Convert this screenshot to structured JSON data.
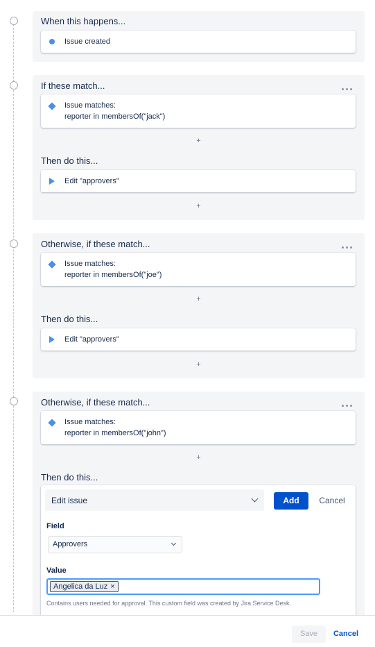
{
  "trigger": {
    "title": "When this happens...",
    "item_label": "Issue created"
  },
  "branch1": {
    "title": "If these match...",
    "condition_line1": "Issue matches:",
    "condition_line2": "reporter in membersOf(\"jack\")",
    "add_symbol": "+",
    "then_title": "Then do this...",
    "action_label": "Edit \"approvers\"",
    "add_symbol2": "+"
  },
  "branch2": {
    "title": "Otherwise, if these match...",
    "condition_line1": "Issue matches:",
    "condition_line2": "reporter in membersOf(\"joe\")",
    "add_symbol": "+",
    "then_title": "Then do this...",
    "action_label": "Edit \"approvers\"",
    "add_symbol2": "+"
  },
  "branch3": {
    "title": "Otherwise, if these match...",
    "condition_line1": "Issue matches:",
    "condition_line2": "reporter in membersOf(\"john\")",
    "add_symbol": "+",
    "then_title": "Then do this..."
  },
  "edit_panel": {
    "action_select_value": "Edit issue",
    "add_label": "Add",
    "cancel_label": "Cancel",
    "field_label": "Field",
    "field_select_value": "Approvers",
    "value_label": "Value",
    "value_tag": "Angelica da Luz",
    "value_tag_remove": "×",
    "help_text": "Contains users needed for approval. This custom field was created by Jira Service Desk."
  },
  "footer": {
    "save_label": "Save",
    "cancel_label": "Cancel"
  },
  "icons": {
    "trigger": "dot-icon",
    "condition": "diamond-icon",
    "action": "play-icon",
    "more": "more-horizontal-icon"
  },
  "colors": {
    "accent_blue": "#4c8fe4",
    "primary_button": "#0052cc",
    "section_bg": "#f4f5f7"
  }
}
